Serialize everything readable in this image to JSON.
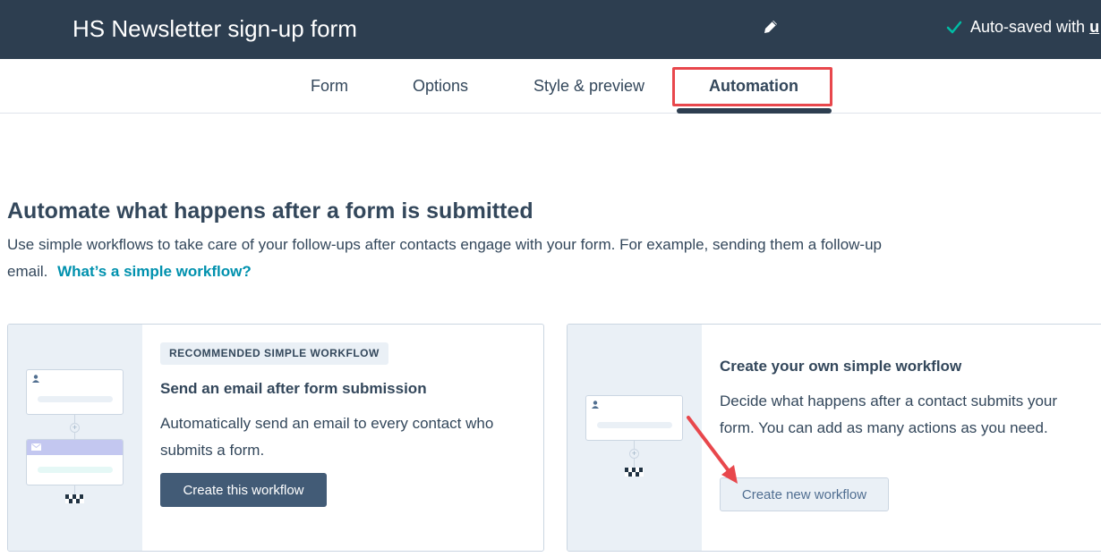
{
  "header": {
    "form_title": "HS Newsletter sign-up form",
    "autosave_text": "Auto-saved with",
    "autosave_link": "u",
    "edit_icon": "pencil-icon",
    "check_icon": "check-icon"
  },
  "tabs": {
    "items": [
      {
        "label": "Form"
      },
      {
        "label": "Options"
      },
      {
        "label": "Style & preview"
      },
      {
        "label": "Automation"
      }
    ],
    "active": "Automation"
  },
  "intro": {
    "heading": "Automate what happens after a form is submitted",
    "body": "Use simple workflows to take care of your follow-ups after contacts engage with your form. For example, sending them a follow-up email.",
    "help_link": "What’s a simple workflow?"
  },
  "cards": [
    {
      "badge": "RECOMMENDED SIMPLE WORKFLOW",
      "title": "Send an email after form submission",
      "description": "Automatically send an email to every contact who submits a form.",
      "button": "Create this workflow"
    },
    {
      "title": "Create your own simple workflow",
      "description": "Decide what happens after a contact submits your form. You can add as many actions as you need.",
      "button": "Create new workflow"
    }
  ],
  "colors": {
    "header_bg": "#2d3e50",
    "accent_link": "#0091ae",
    "check_green": "#00bda5",
    "annotation_red": "#e8474c",
    "primary_button": "#425b76",
    "illustration_bg": "#eaf0f6"
  }
}
